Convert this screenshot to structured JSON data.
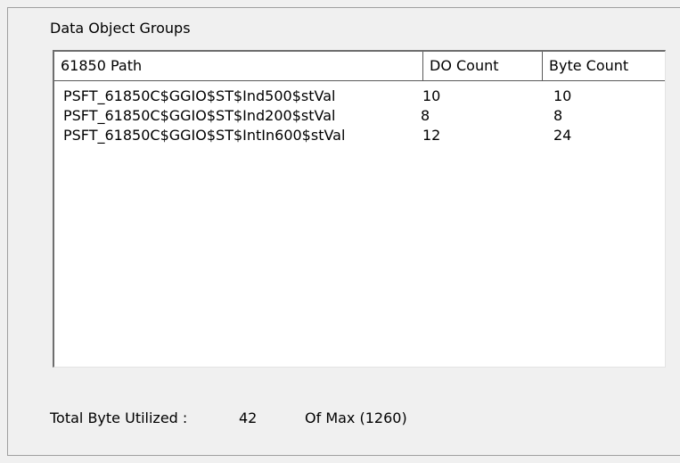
{
  "group": {
    "title": "Data Object Groups"
  },
  "table": {
    "columns": [
      "61850 Path",
      "DO Count",
      "Byte Count"
    ],
    "rows": [
      {
        "path": "PSFT_61850C$GGIO$ST$Ind500$stVal",
        "do_count": "10",
        "byte_count": "10"
      },
      {
        "path": "PSFT_61850C$GGIO$ST$Ind200$stVal",
        "do_count": "8",
        "byte_count": "8"
      },
      {
        "path": "PSFT_61850C$GGIO$ST$IntIn600$stVal",
        "do_count": "12",
        "byte_count": "24"
      }
    ]
  },
  "footer": {
    "total_label": "Total Byte Utilized :",
    "total_value": "42",
    "max_text": "Of Max (1260)"
  }
}
